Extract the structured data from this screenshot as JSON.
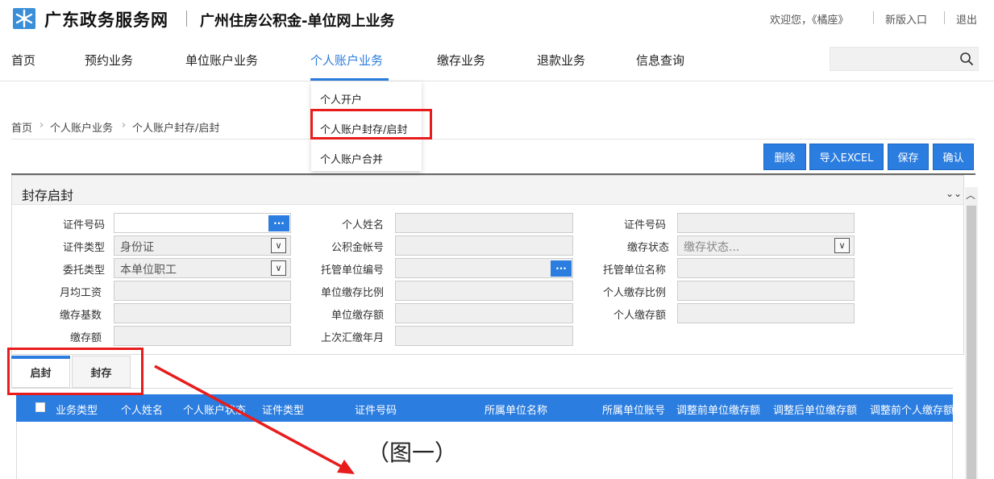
{
  "header": {
    "portal_title": "广东政务服务网",
    "sub_title": "广州住房公积金-单位网上业务",
    "welcome": "欢迎您，《橘座》",
    "new_version": "新版入口",
    "logout": "退出"
  },
  "nav": {
    "items": [
      {
        "label": "首页"
      },
      {
        "label": "预约业务"
      },
      {
        "label": "单位账户业务"
      },
      {
        "label": "个人账户业务"
      },
      {
        "label": "缴存业务"
      },
      {
        "label": "退款业务"
      },
      {
        "label": "信息查询"
      }
    ],
    "active": "个人账户业务",
    "search_placeholder": ""
  },
  "dropdown": {
    "items": [
      {
        "label": "个人开户"
      },
      {
        "label": "个人账户封存/启封"
      },
      {
        "label": "个人账户合并"
      }
    ],
    "highlighted": "个人账户封存/启封"
  },
  "breadcrumb": [
    "首页",
    "个人账户业务",
    "个人账户封存/启封"
  ],
  "buttons": {
    "delete": "删除",
    "import_excel": "导入EXCEL",
    "save": "保存",
    "confirm": "确认"
  },
  "panel": {
    "title": "封存启封",
    "fields": {
      "cert_no": {
        "label": "证件号码",
        "value": ""
      },
      "name": {
        "label": "个人姓名",
        "value": ""
      },
      "cert_no2": {
        "label": "证件号码",
        "value": ""
      },
      "cert_type": {
        "label": "证件类型",
        "value": "身份证"
      },
      "fund_account": {
        "label": "公积金帐号",
        "value": ""
      },
      "deposit_status": {
        "label": "缴存状态",
        "value": "缴存状态..."
      },
      "entrust_type": {
        "label": "委托类型",
        "value": "本单位职工"
      },
      "trustee_no": {
        "label": "托管单位编号",
        "value": ""
      },
      "trustee_name": {
        "label": "托管单位名称",
        "value": ""
      },
      "monthly_wage": {
        "label": "月均工资",
        "value": ""
      },
      "unit_ratio": {
        "label": "单位缴存比例",
        "value": ""
      },
      "personal_ratio": {
        "label": "个人缴存比例",
        "value": ""
      },
      "base": {
        "label": "缴存基数",
        "value": ""
      },
      "unit_amount": {
        "label": "单位缴存额",
        "value": ""
      },
      "personal_amount": {
        "label": "个人缴存额",
        "value": ""
      },
      "amount": {
        "label": "缴存额",
        "value": ""
      },
      "last_month": {
        "label": "上次汇缴年月",
        "value": ""
      }
    }
  },
  "tabs": [
    {
      "label": "启封"
    },
    {
      "label": "封存"
    }
  ],
  "table": {
    "headers": [
      "业务类型",
      "个人姓名",
      "个人账户状态",
      "证件类型",
      "证件号码",
      "所属单位名称",
      "所属单位账号",
      "调整前单位缴存额",
      "调整后单位缴存额",
      "调整前个人缴存额"
    ]
  },
  "caption": "（图一）",
  "colors": {
    "accent": "#2b7de0",
    "annotation": "#e81c1c"
  }
}
